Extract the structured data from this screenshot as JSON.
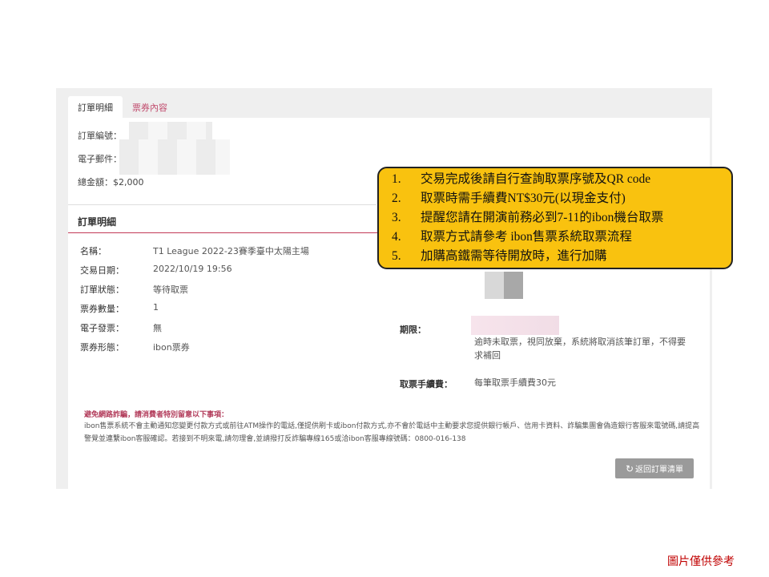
{
  "tabs": [
    {
      "label": "訂單明細",
      "active": true
    },
    {
      "label": "票券內容",
      "active": false
    }
  ],
  "summary": {
    "order_number_label": "訂單編號：",
    "email_label": "電子郵件：",
    "total_label": "總金額：$2,000"
  },
  "section_title": "訂單明細",
  "details": [
    {
      "label": "名稱：",
      "value": "T1 League  2022-23賽季臺中太陽主場"
    },
    {
      "label": "交易日期：",
      "value": "2022/10/19  19:56"
    },
    {
      "label": "訂單狀態：",
      "value": "等待取票"
    },
    {
      "label": "票券數量：",
      "value": "1"
    },
    {
      "label": "電子發票：",
      "value": "無"
    },
    {
      "label": "票券形態：",
      "value": "ibon票券"
    }
  ],
  "right": {
    "deadline_label": "期限：",
    "deadline_text": "逾時未取票，視同放棄，系統將取消該筆訂單，不得要求補回",
    "fee_label": "取票手續費：",
    "fee_value": "每筆取票手續費30元"
  },
  "warning": {
    "title": "避免網路詐騙，請消費者特別留意以下事項：",
    "body": "ibon售票系統不會主動通知您變更付款方式或前往ATM操作的電話,僅提供刷卡或ibon付款方式,亦不會於電話中主動要求您提供銀行帳戶、信用卡資料、詐騙集團會偽造銀行客服來電號碼,請提高警覺並連繫ibon客服確認。若接到不明來電,請勿理會,並請撥打反詐騙專線165或洽ibon客服專線號碼：0800-016-138"
  },
  "back_button": {
    "icon": "refresh-icon",
    "label": "返回訂單清單"
  },
  "callout": {
    "items": [
      {
        "num": "1.",
        "text": "交易完成後請自行查詢取票序號及QR code"
      },
      {
        "num": "2.",
        "text": "取票時需手續費NT$30元(以現金支付)"
      },
      {
        "num": "3.",
        "text": "提醒您請在開演前務必到7-11的ibon機台取票"
      },
      {
        "num": "4.",
        "text": "取票方式請參考 ibon售票系統取票流程"
      },
      {
        "num": "5.",
        "text": "加購高鐵需等待開放時，進行加購"
      }
    ],
    "color": "#f9c20f"
  },
  "footnote": "圖片僅供參考"
}
